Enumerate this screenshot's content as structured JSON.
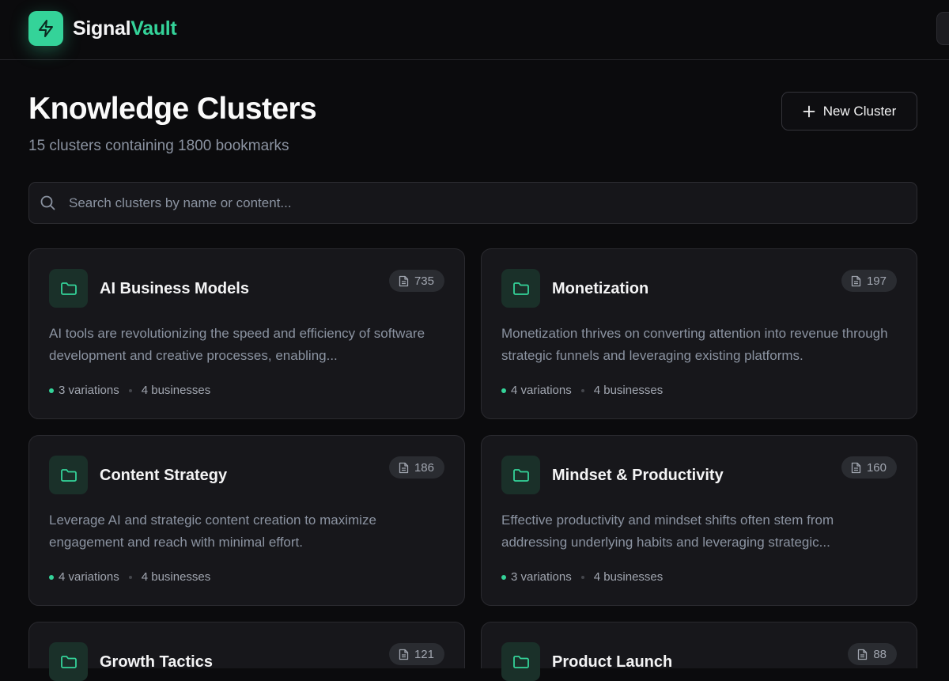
{
  "header": {
    "brand_part1": "Signal",
    "brand_part2": "Vault",
    "icons": {
      "logo": "lightning-bolt-icon"
    },
    "accent": "#34d399"
  },
  "page": {
    "title": "Knowledge Clusters",
    "subtitle": "15 clusters containing 1800 bookmarks",
    "new_button_label": "New Cluster"
  },
  "search": {
    "placeholder": "Search clusters by name or content...",
    "value": ""
  },
  "clusters": [
    {
      "title": "AI Business Models",
      "count": "735",
      "description": "AI tools are revolutionizing the speed and efficiency of software development and creative processes, enabling...",
      "variations": "3 variations",
      "businesses": "4 businesses"
    },
    {
      "title": "Monetization",
      "count": "197",
      "description": "Monetization thrives on converting attention into revenue through strategic funnels and leveraging existing platforms.",
      "variations": "4 variations",
      "businesses": "4 businesses"
    },
    {
      "title": "Content Strategy",
      "count": "186",
      "description": "Leverage AI and strategic content creation to maximize engagement and reach with minimal effort.",
      "variations": "4 variations",
      "businesses": "4 businesses"
    },
    {
      "title": "Mindset & Productivity",
      "count": "160",
      "description": "Effective productivity and mindset shifts often stem from addressing underlying habits and leveraging strategic...",
      "variations": "3 variations",
      "businesses": "4 businesses"
    },
    {
      "title": "Growth Tactics",
      "count": "121"
    },
    {
      "title": "Product Launch",
      "count": "88"
    }
  ]
}
